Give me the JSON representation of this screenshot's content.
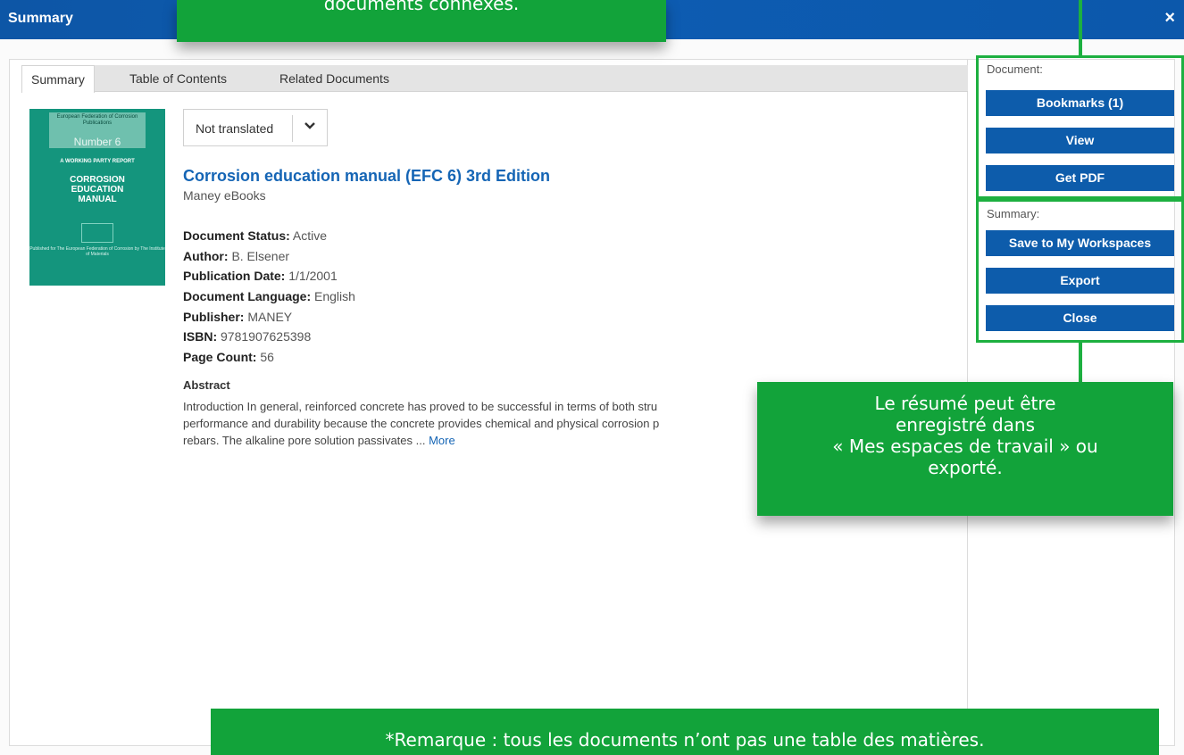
{
  "window": {
    "title": "Summary",
    "close_glyph": "×"
  },
  "tabs": [
    {
      "label": "Summary",
      "active": true
    },
    {
      "label": "Table of Contents",
      "active": false
    },
    {
      "label": "Related Documents",
      "active": false
    }
  ],
  "cover": {
    "publisher_line": "European Federation of Corrosion Publications",
    "number": "Number 6",
    "report": "A WORKING PARTY REPORT",
    "title_lines": [
      "CORROSION",
      "EDUCATION",
      "MANUAL"
    ],
    "published_for": "Published for The European Federation of Corrosion by The Institute of Materials"
  },
  "translate": {
    "value": "Not translated",
    "icon": "chevron-down-icon"
  },
  "document": {
    "title": "Corrosion education manual (EFC 6) 3rd Edition",
    "source": "Maney eBooks",
    "meta": [
      {
        "label": "Document Status:",
        "value": "Active"
      },
      {
        "label": "Author:",
        "value": "B. Elsener"
      },
      {
        "label": "Publication Date:",
        "value": "1/1/2001"
      },
      {
        "label": "Document Language:",
        "value": "English"
      },
      {
        "label": "Publisher:",
        "value": "MANEY"
      },
      {
        "label": "ISBN:",
        "value": "9781907625398"
      },
      {
        "label": "Page Count:",
        "value": "56"
      }
    ],
    "abstract_heading": "Abstract",
    "abstract_lines": [
      "Introduction In general, reinforced concrete has proved to be successful in terms of both stru",
      "performance and durability because the concrete provides chemical and physical corrosion p",
      "rebars. The alkaline pore solution passivates ..."
    ],
    "more_link": "More"
  },
  "sidebar": {
    "document_label": "Document:",
    "document_buttons": [
      "Bookmarks (1)",
      "View",
      "Get PDF"
    ],
    "summary_label": "Summary:",
    "summary_buttons": [
      "Save to My Workspaces",
      "Export",
      "Close"
    ]
  },
  "callouts": {
    "top": "documents connexes.",
    "right_lines": [
      "Le résumé peut être",
      "enregistré dans",
      "« Mes espaces de travail » ou",
      "exporté."
    ],
    "bottom": "*Remarque : tous les documents n’ont pas une table des matières."
  },
  "colors": {
    "title_bar": "#0d5cb2",
    "button": "#0d5cab",
    "callout_green": "#12a33a",
    "highlight_green": "#1db040",
    "link": "#1565b5"
  }
}
